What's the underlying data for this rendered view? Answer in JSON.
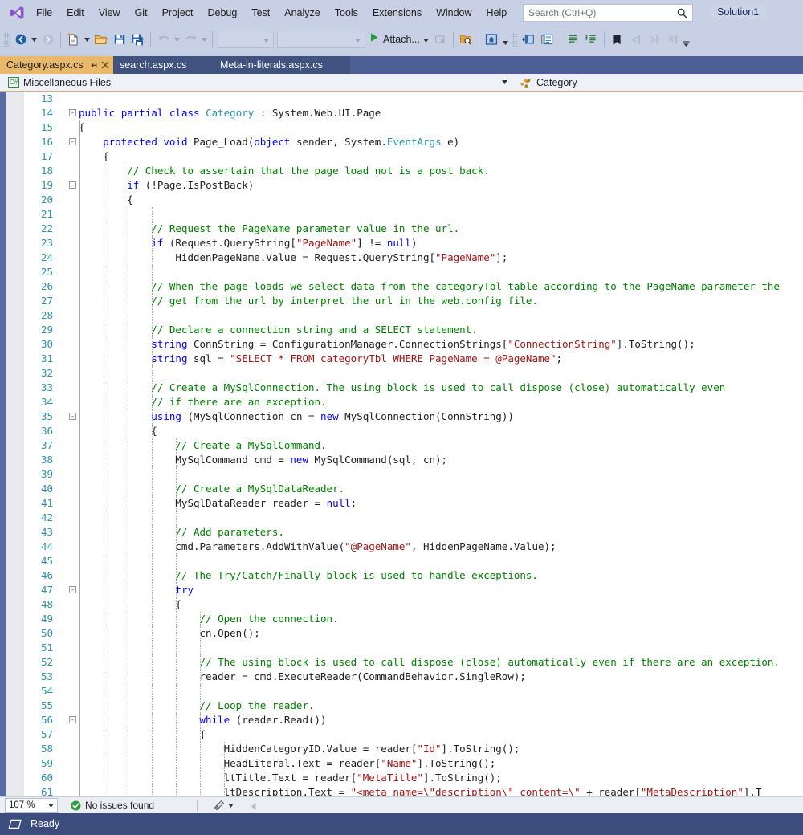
{
  "app": {
    "title": "Visual Studio",
    "logo_icon": "visual-studio-logo",
    "solution_name": "Solution1"
  },
  "menu": {
    "items": [
      {
        "label": "File"
      },
      {
        "label": "Edit"
      },
      {
        "label": "View"
      },
      {
        "label": "Git"
      },
      {
        "label": "Project"
      },
      {
        "label": "Debug"
      },
      {
        "label": "Test"
      },
      {
        "label": "Analyze"
      },
      {
        "label": "Tools"
      },
      {
        "label": "Extensions"
      },
      {
        "label": "Window"
      },
      {
        "label": "Help"
      }
    ]
  },
  "search": {
    "placeholder": "Search (Ctrl+Q)",
    "value": "",
    "icon": "search-icon"
  },
  "toolbar": {
    "attach_label": "Attach...",
    "combo1_value": "",
    "combo2_value": "",
    "buttons": [
      {
        "name": "navigate-backward",
        "icon": "back-arrow-icon"
      },
      {
        "name": "navigate-forward",
        "icon": "forward-arrow-icon"
      },
      {
        "name": "new-project",
        "icon": "new-file-icon"
      },
      {
        "name": "open-file",
        "icon": "open-folder-icon"
      },
      {
        "name": "save",
        "icon": "save-icon"
      },
      {
        "name": "save-all",
        "icon": "save-all-icon"
      },
      {
        "name": "undo",
        "icon": "undo-icon"
      },
      {
        "name": "redo",
        "icon": "redo-icon"
      },
      {
        "name": "attach-to-process",
        "icon": "play-icon"
      },
      {
        "name": "stop-debug",
        "icon": "stop-icon"
      },
      {
        "name": "find-in-files",
        "icon": "folder-search-icon"
      },
      {
        "name": "preview-selected",
        "icon": "home-window-icon"
      },
      {
        "name": "toggle-solution-explorer",
        "icon": "panel-icon"
      },
      {
        "name": "properties-window",
        "icon": "properties-icon"
      },
      {
        "name": "comment-selection",
        "icon": "comment-lines-icon"
      },
      {
        "name": "uncomment-selection",
        "icon": "uncomment-lines-icon"
      },
      {
        "name": "toggle-bookmark",
        "icon": "bookmark-icon"
      },
      {
        "name": "previous-bookmark",
        "icon": "prev-bookmark-icon"
      },
      {
        "name": "next-bookmark",
        "icon": "next-bookmark-icon"
      },
      {
        "name": "clear-bookmarks",
        "icon": "clear-bookmark-icon"
      }
    ]
  },
  "tabs": [
    {
      "label": "Category.aspx.cs",
      "active": true,
      "pinned": true,
      "closable": true
    },
    {
      "label": "search.aspx.cs",
      "active": false,
      "pinned": false,
      "closable": false
    },
    {
      "label": "Meta-in-literals.aspx.cs",
      "active": false,
      "pinned": false,
      "closable": false
    }
  ],
  "navbar": {
    "project_badge": "C#",
    "project_label": "Miscellaneous Files",
    "member_icon": "class-icon",
    "member_label": "Category"
  },
  "editor": {
    "first_line": 13,
    "zoom": "107 %",
    "lines": [
      {
        "n": 13,
        "fold": "",
        "indent": 0,
        "tokens": []
      },
      {
        "n": 14,
        "fold": "-",
        "indent": 0,
        "tokens": [
          {
            "t": "k",
            "v": "public"
          },
          {
            "t": "p",
            "v": " "
          },
          {
            "t": "k",
            "v": "partial"
          },
          {
            "t": "p",
            "v": " "
          },
          {
            "t": "k",
            "v": "class"
          },
          {
            "t": "p",
            "v": " "
          },
          {
            "t": "t",
            "v": "Category"
          },
          {
            "t": "p",
            "v": " : System.Web.UI.Page"
          }
        ]
      },
      {
        "n": 15,
        "fold": "",
        "indent": 1,
        "tokens": [
          {
            "t": "p",
            "v": "{"
          }
        ]
      },
      {
        "n": 16,
        "fold": "-",
        "indent": 1,
        "tokens": [
          {
            "t": "p",
            "v": "    "
          },
          {
            "t": "k",
            "v": "protected"
          },
          {
            "t": "p",
            "v": " "
          },
          {
            "t": "k",
            "v": "void"
          },
          {
            "t": "p",
            "v": " Page_Load("
          },
          {
            "t": "k",
            "v": "object"
          },
          {
            "t": "p",
            "v": " sender, System."
          },
          {
            "t": "t",
            "v": "EventArgs"
          },
          {
            "t": "p",
            "v": " e)"
          }
        ]
      },
      {
        "n": 17,
        "fold": "",
        "indent": 2,
        "tokens": [
          {
            "t": "p",
            "v": "    {"
          }
        ]
      },
      {
        "n": 18,
        "fold": "",
        "indent": 3,
        "tokens": [
          {
            "t": "c",
            "v": "        // Check to assertain that the page load not is a post back."
          }
        ]
      },
      {
        "n": 19,
        "fold": "-",
        "indent": 3,
        "tokens": [
          {
            "t": "p",
            "v": "        "
          },
          {
            "t": "k",
            "v": "if"
          },
          {
            "t": "p",
            "v": " (!Page.IsPostBack)"
          }
        ]
      },
      {
        "n": 20,
        "fold": "",
        "indent": 3,
        "tokens": [
          {
            "t": "p",
            "v": "        {"
          }
        ]
      },
      {
        "n": 21,
        "fold": "",
        "indent": 4,
        "tokens": []
      },
      {
        "n": 22,
        "fold": "",
        "indent": 4,
        "tokens": [
          {
            "t": "c",
            "v": "            // Request the PageName parameter value in the url."
          }
        ]
      },
      {
        "n": 23,
        "fold": "",
        "indent": 4,
        "tokens": [
          {
            "t": "p",
            "v": "            "
          },
          {
            "t": "k",
            "v": "if"
          },
          {
            "t": "p",
            "v": " (Request.QueryString["
          },
          {
            "t": "s",
            "v": "\"PageName\""
          },
          {
            "t": "p",
            "v": "] != "
          },
          {
            "t": "k",
            "v": "null"
          },
          {
            "t": "p",
            "v": ")"
          }
        ]
      },
      {
        "n": 24,
        "fold": "",
        "indent": 4,
        "tokens": [
          {
            "t": "p",
            "v": "                HiddenPageName.Value = Request.QueryString["
          },
          {
            "t": "s",
            "v": "\"PageName\""
          },
          {
            "t": "p",
            "v": "];"
          }
        ]
      },
      {
        "n": 25,
        "fold": "",
        "indent": 4,
        "tokens": []
      },
      {
        "n": 26,
        "fold": "",
        "indent": 4,
        "tokens": [
          {
            "t": "c",
            "v": "            // When the page loads we select data from the categoryTbl table according to the PageName parameter the"
          }
        ]
      },
      {
        "n": 27,
        "fold": "",
        "indent": 4,
        "tokens": [
          {
            "t": "c",
            "v": "            // get from the url by interpret the url in the web.config file."
          }
        ]
      },
      {
        "n": 28,
        "fold": "",
        "indent": 4,
        "tokens": []
      },
      {
        "n": 29,
        "fold": "",
        "indent": 4,
        "tokens": [
          {
            "t": "c",
            "v": "            // Declare a connection string and a SELECT statement."
          }
        ]
      },
      {
        "n": 30,
        "fold": "",
        "indent": 4,
        "tokens": [
          {
            "t": "p",
            "v": "            "
          },
          {
            "t": "k",
            "v": "string"
          },
          {
            "t": "p",
            "v": " ConnString = ConfigurationManager.ConnectionStrings["
          },
          {
            "t": "s",
            "v": "\"ConnectionString\""
          },
          {
            "t": "p",
            "v": "].ToString();"
          }
        ]
      },
      {
        "n": 31,
        "fold": "",
        "indent": 4,
        "tokens": [
          {
            "t": "p",
            "v": "            "
          },
          {
            "t": "k",
            "v": "string"
          },
          {
            "t": "p",
            "v": " sql = "
          },
          {
            "t": "s",
            "v": "\"SELECT * FROM categoryTbl WHERE PageName = @PageName\""
          },
          {
            "t": "p",
            "v": ";"
          }
        ]
      },
      {
        "n": 32,
        "fold": "",
        "indent": 4,
        "tokens": []
      },
      {
        "n": 33,
        "fold": "",
        "indent": 4,
        "tokens": [
          {
            "t": "c",
            "v": "            // Create a MySqlConnection. The using block is used to call dispose (close) automatically even"
          }
        ]
      },
      {
        "n": 34,
        "fold": "",
        "indent": 4,
        "tokens": [
          {
            "t": "c",
            "v": "            // if there are an exception."
          }
        ]
      },
      {
        "n": 35,
        "fold": "-",
        "indent": 4,
        "tokens": [
          {
            "t": "p",
            "v": "            "
          },
          {
            "t": "k",
            "v": "using"
          },
          {
            "t": "p",
            "v": " (MySqlConnection cn = "
          },
          {
            "t": "k",
            "v": "new"
          },
          {
            "t": "p",
            "v": " MySqlConnection(ConnString))"
          }
        ]
      },
      {
        "n": 36,
        "fold": "",
        "indent": 4,
        "tokens": [
          {
            "t": "p",
            "v": "            {"
          }
        ]
      },
      {
        "n": 37,
        "fold": "",
        "indent": 5,
        "tokens": [
          {
            "t": "c",
            "v": "                // Create a MySqlCommand."
          }
        ]
      },
      {
        "n": 38,
        "fold": "",
        "indent": 5,
        "tokens": [
          {
            "t": "p",
            "v": "                MySqlCommand cmd = "
          },
          {
            "t": "k",
            "v": "new"
          },
          {
            "t": "p",
            "v": " MySqlCommand(sql, cn);"
          }
        ]
      },
      {
        "n": 39,
        "fold": "",
        "indent": 5,
        "tokens": []
      },
      {
        "n": 40,
        "fold": "",
        "indent": 5,
        "tokens": [
          {
            "t": "c",
            "v": "                // Create a MySqlDataReader."
          }
        ]
      },
      {
        "n": 41,
        "fold": "",
        "indent": 5,
        "tokens": [
          {
            "t": "p",
            "v": "                MySqlDataReader reader = "
          },
          {
            "t": "k",
            "v": "null"
          },
          {
            "t": "p",
            "v": ";"
          }
        ]
      },
      {
        "n": 42,
        "fold": "",
        "indent": 5,
        "tokens": []
      },
      {
        "n": 43,
        "fold": "",
        "indent": 5,
        "tokens": [
          {
            "t": "c",
            "v": "                // Add parameters."
          }
        ]
      },
      {
        "n": 44,
        "fold": "",
        "indent": 5,
        "tokens": [
          {
            "t": "p",
            "v": "                cmd.Parameters.AddWithValue("
          },
          {
            "t": "s",
            "v": "\"@PageName\""
          },
          {
            "t": "p",
            "v": ", HiddenPageName.Value);"
          }
        ]
      },
      {
        "n": 45,
        "fold": "",
        "indent": 5,
        "tokens": []
      },
      {
        "n": 46,
        "fold": "",
        "indent": 5,
        "tokens": [
          {
            "t": "c",
            "v": "                // The Try/Catch/Finally block is used to handle exceptions."
          }
        ]
      },
      {
        "n": 47,
        "fold": "-",
        "indent": 5,
        "tokens": [
          {
            "t": "p",
            "v": "                "
          },
          {
            "t": "k",
            "v": "try"
          }
        ]
      },
      {
        "n": 48,
        "fold": "",
        "indent": 5,
        "tokens": [
          {
            "t": "p",
            "v": "                {"
          }
        ]
      },
      {
        "n": 49,
        "fold": "",
        "indent": 6,
        "tokens": [
          {
            "t": "c",
            "v": "                    // Open the connection."
          }
        ]
      },
      {
        "n": 50,
        "fold": "",
        "indent": 6,
        "tokens": [
          {
            "t": "p",
            "v": "                    cn.Open();"
          }
        ]
      },
      {
        "n": 51,
        "fold": "",
        "indent": 6,
        "tokens": []
      },
      {
        "n": 52,
        "fold": "",
        "indent": 6,
        "tokens": [
          {
            "t": "c",
            "v": "                    // The using block is used to call dispose (close) automatically even if there are an exception."
          }
        ]
      },
      {
        "n": 53,
        "fold": "",
        "indent": 6,
        "tokens": [
          {
            "t": "p",
            "v": "                    reader = cmd.ExecuteReader(CommandBehavior.SingleRow);"
          }
        ]
      },
      {
        "n": 54,
        "fold": "",
        "indent": 6,
        "tokens": []
      },
      {
        "n": 55,
        "fold": "",
        "indent": 6,
        "tokens": [
          {
            "t": "c",
            "v": "                    // Loop the reader."
          }
        ]
      },
      {
        "n": 56,
        "fold": "-",
        "indent": 6,
        "tokens": [
          {
            "t": "p",
            "v": "                    "
          },
          {
            "t": "k",
            "v": "while"
          },
          {
            "t": "p",
            "v": " (reader.Read())"
          }
        ]
      },
      {
        "n": 57,
        "fold": "",
        "indent": 6,
        "tokens": [
          {
            "t": "p",
            "v": "                    {"
          }
        ]
      },
      {
        "n": 58,
        "fold": "",
        "indent": 7,
        "tokens": [
          {
            "t": "p",
            "v": "                        HiddenCategoryID.Value = reader["
          },
          {
            "t": "s",
            "v": "\"Id\""
          },
          {
            "t": "p",
            "v": "].ToString();"
          }
        ]
      },
      {
        "n": 59,
        "fold": "",
        "indent": 7,
        "tokens": [
          {
            "t": "p",
            "v": "                        HeadLiteral.Text = reader["
          },
          {
            "t": "s",
            "v": "\"Name\""
          },
          {
            "t": "p",
            "v": "].ToString();"
          }
        ]
      },
      {
        "n": 60,
        "fold": "",
        "indent": 7,
        "tokens": [
          {
            "t": "p",
            "v": "                        ltTitle.Text = reader["
          },
          {
            "t": "s",
            "v": "\"MetaTitle\""
          },
          {
            "t": "p",
            "v": "].ToString();"
          }
        ]
      },
      {
        "n": 61,
        "fold": "",
        "indent": 7,
        "tokens": [
          {
            "t": "p",
            "v": "                        ltDescription.Text = "
          },
          {
            "t": "s",
            "v": "\"<meta name=\\\"description\\\" content=\\\""
          },
          {
            "t": "p",
            "v": " + reader["
          },
          {
            "t": "s",
            "v": "\"MetaDescription\""
          },
          {
            "t": "p",
            "v": "].T"
          }
        ]
      }
    ]
  },
  "editor_bottom": {
    "zoom_value": "107 %",
    "issues_text": "No issues found",
    "issues_icon": "check-circle-icon",
    "brush_icon": "brush-icon",
    "scroll_left_icon": "scroll-left-icon"
  },
  "statusbar": {
    "icon": "ready-icon",
    "text": "Ready"
  }
}
